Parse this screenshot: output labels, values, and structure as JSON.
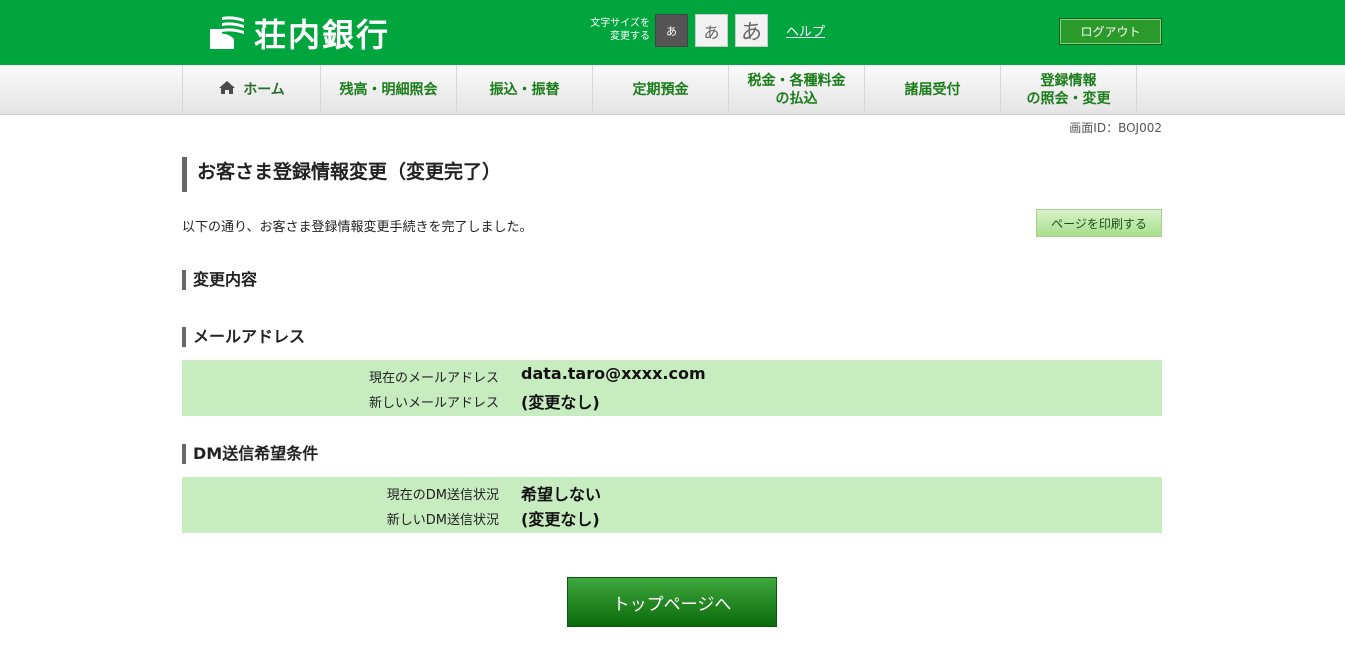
{
  "header": {
    "bank_name": "荘内銀行",
    "fontsize_label_line1": "文字サイズを",
    "fontsize_label_line2": "変更する",
    "fontsize_small": "あ",
    "fontsize_medium": "あ",
    "fontsize_large": "あ",
    "help_label": "ヘルプ",
    "logout_label": "ログアウト"
  },
  "nav": {
    "items": [
      {
        "line1": "ホーム",
        "line2": ""
      },
      {
        "line1": "残高・明細照会",
        "line2": ""
      },
      {
        "line1": "振込・振替",
        "line2": ""
      },
      {
        "line1": "定期預金",
        "line2": ""
      },
      {
        "line1": "税金・各種料金",
        "line2": "の払込"
      },
      {
        "line1": "諸届受付",
        "line2": ""
      },
      {
        "line1": "登録情報",
        "line2": "の照会・変更"
      }
    ]
  },
  "screen_id": "画面ID：BOJ002",
  "page": {
    "title": "お客さま登録情報変更（変更完了）",
    "intro": "以下の通り、お客さま登録情報変更手続きを完了しました。",
    "print_button": "ページを印刷する"
  },
  "sections": {
    "changes_heading": "変更内容",
    "email": {
      "heading": "メールアドレス",
      "current_label": "現在のメールアドレス",
      "current_value": "data.taro@xxxx.com",
      "new_label": "新しいメールアドレス",
      "new_value": "(変更なし)"
    },
    "dm": {
      "heading": "DM送信希望条件",
      "current_label": "現在のDM送信状況",
      "current_value": "希望しない",
      "new_label": "新しいDM送信状況",
      "new_value": "(変更なし)"
    }
  },
  "top_button": "トップページへ",
  "colors": {
    "brand_green": "#00a53e",
    "nav_text": "#1b7c1b",
    "info_bg": "#c6ecbf"
  }
}
